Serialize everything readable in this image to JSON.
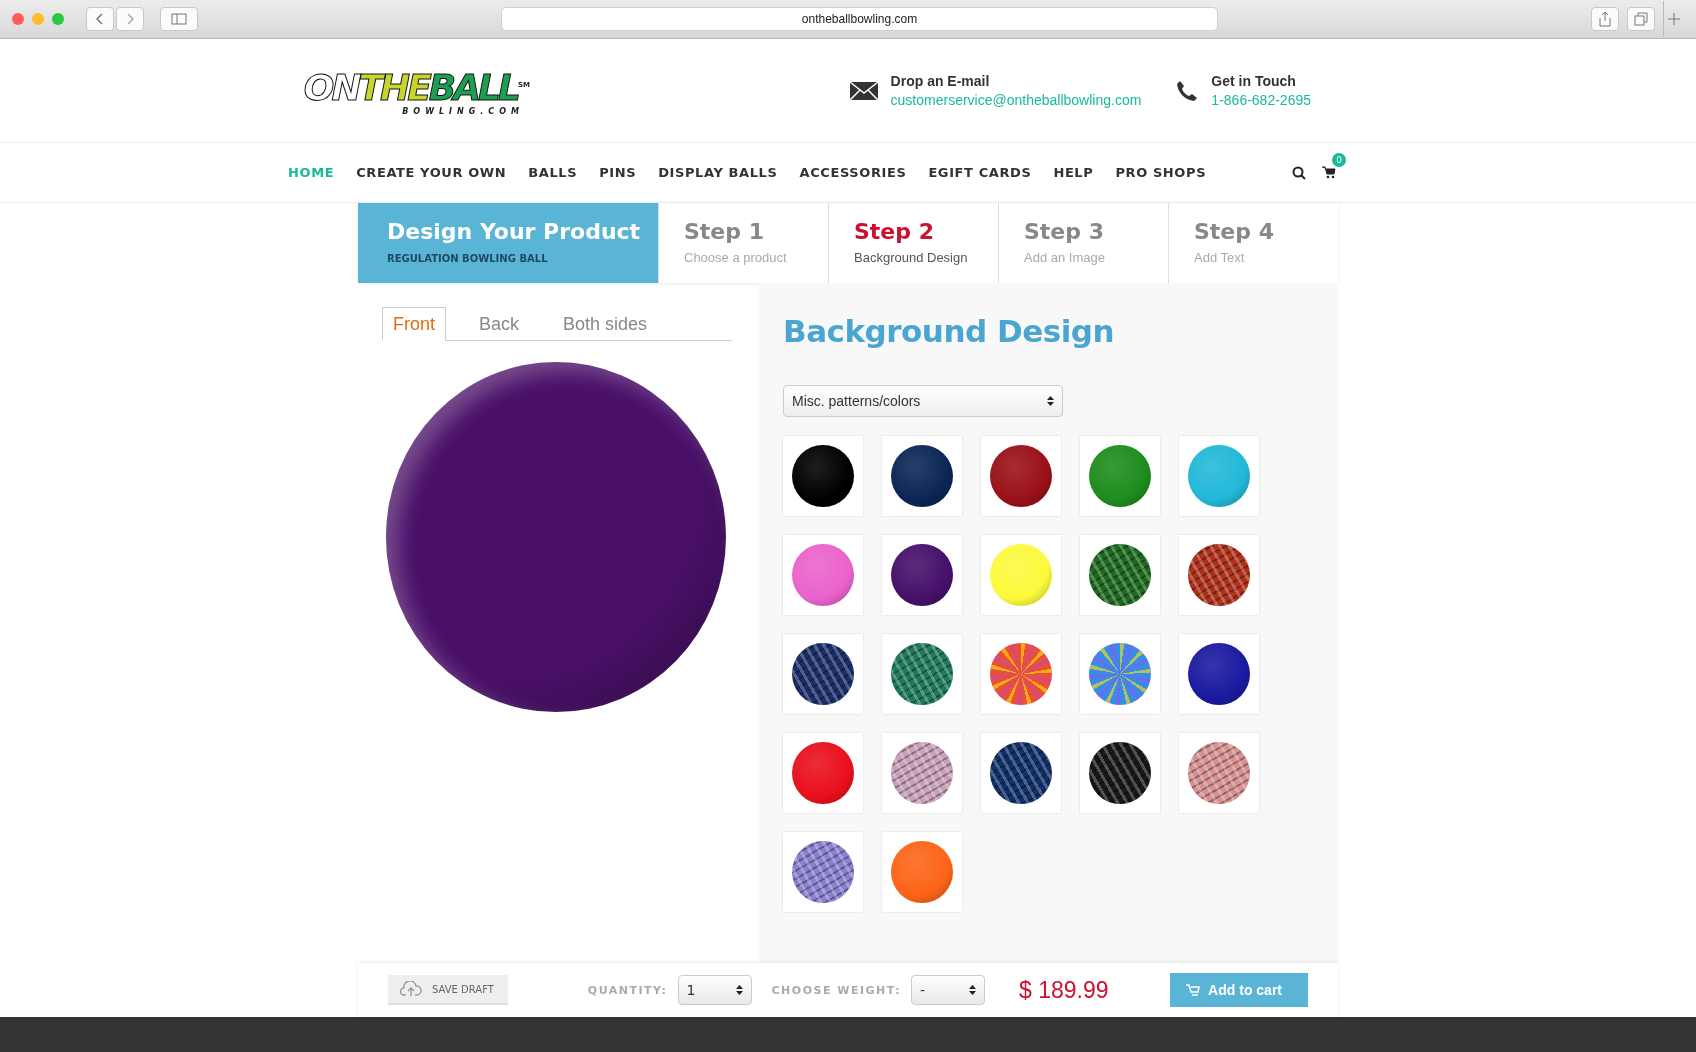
{
  "browser": {
    "url": "ontheballbowling.com"
  },
  "header": {
    "logo": {
      "part_1": "ON",
      "part_2": "THE",
      "part_3": "BALL",
      "mark": "SM",
      "sub": "BOWLING.COM"
    },
    "contacts": [
      {
        "kind": "mail",
        "title": "Drop an E-mail",
        "value": "customerservice@ontheballbowling.com"
      },
      {
        "kind": "phone",
        "title": "Get in Touch",
        "value": "1-866-682-2695"
      }
    ]
  },
  "nav": {
    "items": [
      {
        "label": "HOME",
        "selected": true
      },
      {
        "label": "CREATE YOUR OWN",
        "selected": false
      },
      {
        "label": "BALLS",
        "selected": false
      },
      {
        "label": "PINS",
        "selected": false
      },
      {
        "label": "DISPLAY BALLS",
        "selected": false
      },
      {
        "label": "ACCESSORIES",
        "selected": false
      },
      {
        "label": "EGIFT CARDS",
        "selected": false
      },
      {
        "label": "HELP",
        "selected": false
      },
      {
        "label": "PRO SHOPS",
        "selected": false
      }
    ],
    "cart_count": "0"
  },
  "designer": {
    "title": "Design Your Product",
    "subtitle": "REGULATION BOWLING BALL",
    "steps": [
      {
        "label": "Step 1",
        "caption": "Choose a product",
        "selected": false
      },
      {
        "label": "Step 2",
        "caption": "Background Design",
        "selected": true
      },
      {
        "label": "Step 3",
        "caption": "Add an Image",
        "selected": false
      },
      {
        "label": "Step 4",
        "caption": "Add Text",
        "selected": false
      }
    ],
    "side_tabs": [
      {
        "label": "Front",
        "selected": true
      },
      {
        "label": "Back",
        "selected": false
      },
      {
        "label": "Both sides",
        "selected": false
      }
    ],
    "panel_title": "Background Design",
    "category": "Misc. patterns/colors",
    "swatches": [
      {
        "kind": "solid",
        "color": "#000000"
      },
      {
        "kind": "solid",
        "color": "#0b2556"
      },
      {
        "kind": "solid",
        "color": "#9a1018"
      },
      {
        "kind": "solid",
        "color": "#1e8c1e"
      },
      {
        "kind": "solid",
        "color": "#22b8d8"
      },
      {
        "kind": "solid",
        "color": "#ea62cc"
      },
      {
        "kind": "solid",
        "color": "#46106a"
      },
      {
        "kind": "solid",
        "color": "#fcfa3c"
      },
      {
        "kind": "pattern",
        "color": "#1d6a1e"
      },
      {
        "kind": "pattern",
        "color": "#b0301a"
      },
      {
        "kind": "pattern",
        "color": "#1a2e6a"
      },
      {
        "kind": "pattern",
        "color": "#1f7a5a"
      },
      {
        "kind": "tiedye",
        "color": "#e8503a"
      },
      {
        "kind": "tiedye",
        "color": "#3a8ae8"
      },
      {
        "kind": "solid",
        "color": "#1a1aa0"
      },
      {
        "kind": "solid",
        "color": "#e8101c"
      },
      {
        "kind": "pattern",
        "color": "#c8a0b8"
      },
      {
        "kind": "pattern",
        "color": "#10306a"
      },
      {
        "kind": "pattern",
        "color": "#181818"
      },
      {
        "kind": "pattern",
        "color": "#d89090"
      },
      {
        "kind": "pattern",
        "color": "#8880d0"
      },
      {
        "kind": "solid",
        "color": "#fc6418"
      }
    ]
  },
  "footer_bar": {
    "save": "SAVE DRAFT",
    "quantity_label": "QUANTITY:",
    "quantity": "1",
    "weight_label": "CHOOSE WEIGHT:",
    "weight": "-",
    "price": "$ 189.99",
    "add": "Add to cart"
  }
}
